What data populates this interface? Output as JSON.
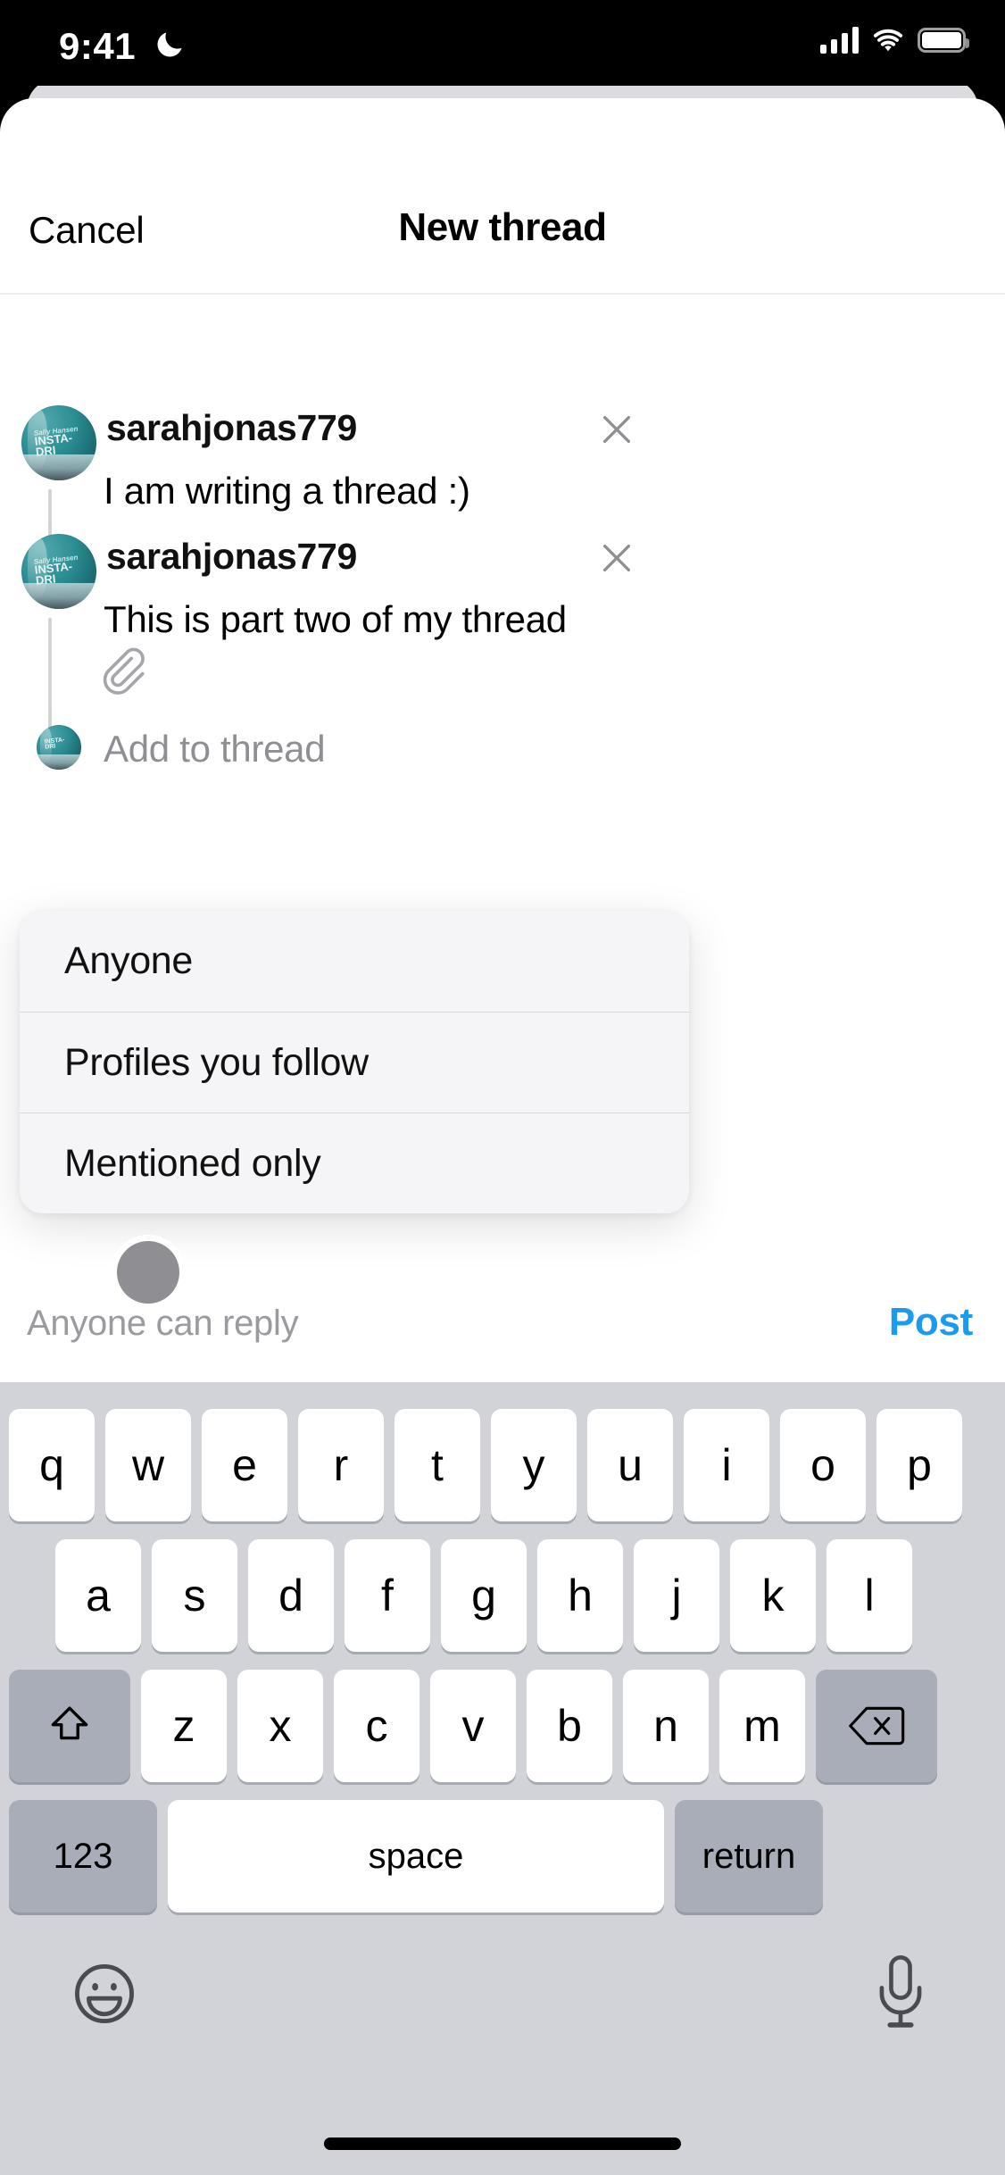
{
  "status_bar": {
    "time": "9:41",
    "icons": [
      "moon-icon",
      "cellular-signal-icon",
      "wifi-icon",
      "battery-icon"
    ]
  },
  "header": {
    "cancel_label": "Cancel",
    "title": "New thread"
  },
  "composer": {
    "posts": [
      {
        "username": "sarahjonas779",
        "text": "I am writing a thread :)",
        "avatar_brand": "Sally Hansen",
        "avatar_line1": "INSTA-",
        "avatar_line2": "DRI",
        "close_icon": "close-icon",
        "has_attachment": false
      },
      {
        "username": "sarahjonas779",
        "text": "This is part two of my thread",
        "avatar_brand": "Sally Hansen",
        "avatar_line1": "INSTA-",
        "avatar_line2": "DRI",
        "close_icon": "close-icon",
        "has_attachment": true,
        "attachment_icon": "paperclip-icon"
      }
    ],
    "add_row": {
      "placeholder": "Add to thread"
    }
  },
  "reply_dropdown": {
    "visible": true,
    "options": [
      "Anyone",
      "Profiles you follow",
      "Mentioned only"
    ],
    "selected": "Anyone"
  },
  "bottom_bar": {
    "reply_setting": "Anyone can reply",
    "post_label": "Post",
    "post_color": "#1b9bf0"
  },
  "keyboard": {
    "row1": [
      "q",
      "w",
      "e",
      "r",
      "t",
      "y",
      "u",
      "i",
      "o",
      "p"
    ],
    "row2": [
      "a",
      "s",
      "d",
      "f",
      "g",
      "h",
      "j",
      "k",
      "l"
    ],
    "row3_letters": [
      "z",
      "x",
      "c",
      "v",
      "b",
      "n",
      "m"
    ],
    "shift_icon": "shift-icon",
    "backspace_icon": "backspace-icon",
    "numbers_label": "123",
    "space_label": "space",
    "return_label": "return",
    "emoji_icon": "emoji-icon",
    "mic_icon": "microphone-icon"
  }
}
